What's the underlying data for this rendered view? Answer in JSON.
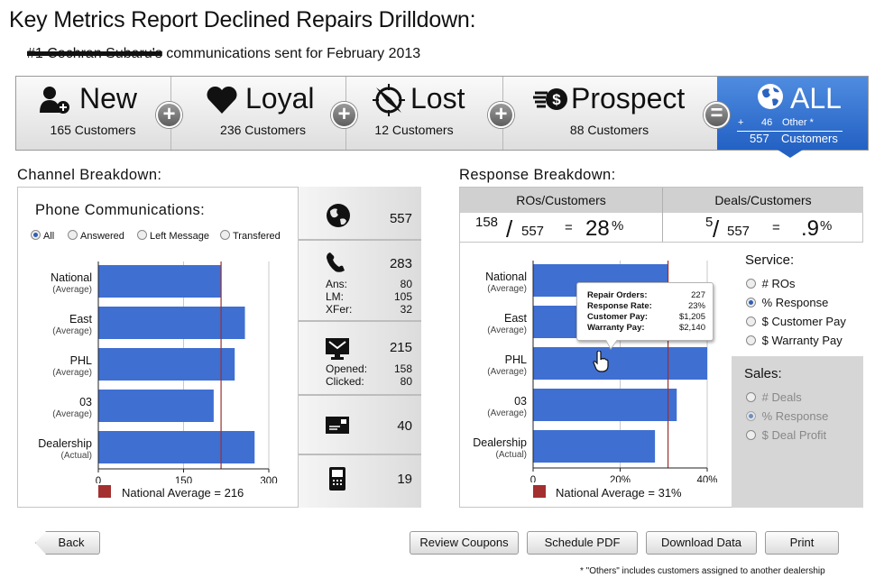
{
  "page": {
    "title": "Key Metrics Report Declined Repairs Drilldown:",
    "subtitle_struck": "#1 Cochran Subaru's",
    "subtitle_rest": " communications sent for February 2013"
  },
  "segments": [
    {
      "label": "New",
      "count": "165 Customers",
      "icon": "new-user-icon"
    },
    {
      "label": "Loyal",
      "count": "236 Customers",
      "icon": "heart-icon"
    },
    {
      "label": "Lost",
      "count": "12 Customers",
      "icon": "compass-icon"
    },
    {
      "label": "Prospect",
      "count": "88 Customers",
      "icon": "dollar-wings-icon"
    }
  ],
  "operators": [
    "+",
    "+",
    "+",
    "="
  ],
  "all_segment": {
    "label": "ALL",
    "plus": "+",
    "others_count": "46",
    "others_label": "Other *",
    "total_count": "557",
    "total_label": "Customers",
    "icon": "globe-icon",
    "color": "#2f6ecf"
  },
  "channel": {
    "heading": "Channel Breakdown:",
    "panel_title": "Phone Communications:",
    "filters": [
      {
        "label": "All",
        "selected": true
      },
      {
        "label": "Answered",
        "selected": false
      },
      {
        "label": "Left Message",
        "selected": false
      },
      {
        "label": "Transfered",
        "selected": false
      }
    ],
    "legend": "National Average = 216",
    "stats": {
      "globe_total": "557",
      "phone_total": "283",
      "phone_breakdown": [
        {
          "label": "Ans:",
          "value": "80"
        },
        {
          "label": "LM:",
          "value": "105"
        },
        {
          "label": "XFer:",
          "value": "32"
        }
      ],
      "email_total": "215",
      "email_breakdown": [
        {
          "label": "Opened:",
          "value": "158"
        },
        {
          "label": "Clicked:",
          "value": "80"
        }
      ],
      "mail_total": "40",
      "sms_total": "19"
    }
  },
  "response": {
    "heading": "Response Breakdown:",
    "col1_header": "ROs/Customers",
    "col2_header": "Deals/Customers",
    "col1_num": "158",
    "col1_den": "557",
    "col1_eq": "=",
    "col1_pct": "28",
    "col2_num": "5",
    "col2_den": "557",
    "col2_eq": "=",
    "col2_pct": ".9",
    "pct_sign": "%",
    "slash": "/",
    "legend": "National Average = 31%",
    "service_heading": "Service:",
    "service_options": [
      {
        "label": "# ROs",
        "selected": false
      },
      {
        "label": "% Response",
        "selected": true
      },
      {
        "label": "$ Customer Pay",
        "selected": false
      },
      {
        "label": "$ Warranty Pay",
        "selected": false
      }
    ],
    "sales_heading": "Sales:",
    "sales_options": [
      {
        "label": "# Deals",
        "selected": false
      },
      {
        "label": "% Response",
        "selected": true
      },
      {
        "label": "$ Deal Profit",
        "selected": false
      }
    ],
    "tooltip": [
      {
        "label": "Repair Orders:",
        "value": "227"
      },
      {
        "label": "Response Rate:",
        "value": "23%"
      },
      {
        "label": "Customer Pay:",
        "value": "$1,205"
      },
      {
        "label": "Warranty Pay:",
        "value": "$2,140"
      }
    ]
  },
  "buttons": {
    "back": "Back",
    "review_coupons": "Review Coupons",
    "schedule_pdf": "Schedule PDF",
    "download_data": "Download Data",
    "print": "Print"
  },
  "footnote": "*   \"Others\" includes customers assigned to another dealership",
  "colors": {
    "bar": "#3f6fd1",
    "avg_line": "#9b2f2f",
    "legend_swatch": "#a32f2f",
    "accent": "#2f6ecf"
  },
  "chart_data": [
    {
      "type": "bar",
      "orientation": "horizontal",
      "categories": [
        {
          "name": "National",
          "sub": "(Average)"
        },
        {
          "name": "East",
          "sub": "(Average)"
        },
        {
          "name": "PHL",
          "sub": "(Average)"
        },
        {
          "name": "03",
          "sub": "(Average)"
        },
        {
          "name": "Dealership",
          "sub": "(Actual)"
        }
      ],
      "values": [
        216,
        258,
        240,
        203,
        275
      ],
      "xlim": [
        0,
        300
      ],
      "ticks": [
        "0",
        "150",
        "300"
      ],
      "tick_values": [
        0,
        150,
        300
      ],
      "reference_line": 216,
      "grid": true
    },
    {
      "type": "bar",
      "orientation": "horizontal",
      "categories": [
        {
          "name": "National",
          "sub": "(Average)"
        },
        {
          "name": "East",
          "sub": "(Average)"
        },
        {
          "name": "PHL",
          "sub": "(Average)"
        },
        {
          "name": "03",
          "sub": "(Average)"
        },
        {
          "name": "Dealership",
          "sub": "(Actual)"
        }
      ],
      "values": [
        31,
        29,
        40,
        33,
        28
      ],
      "xlim": [
        0,
        40
      ],
      "ticks": [
        "0",
        "20%",
        "40%"
      ],
      "tick_values": [
        0,
        20,
        40
      ],
      "reference_line": 31,
      "grid": true
    }
  ]
}
